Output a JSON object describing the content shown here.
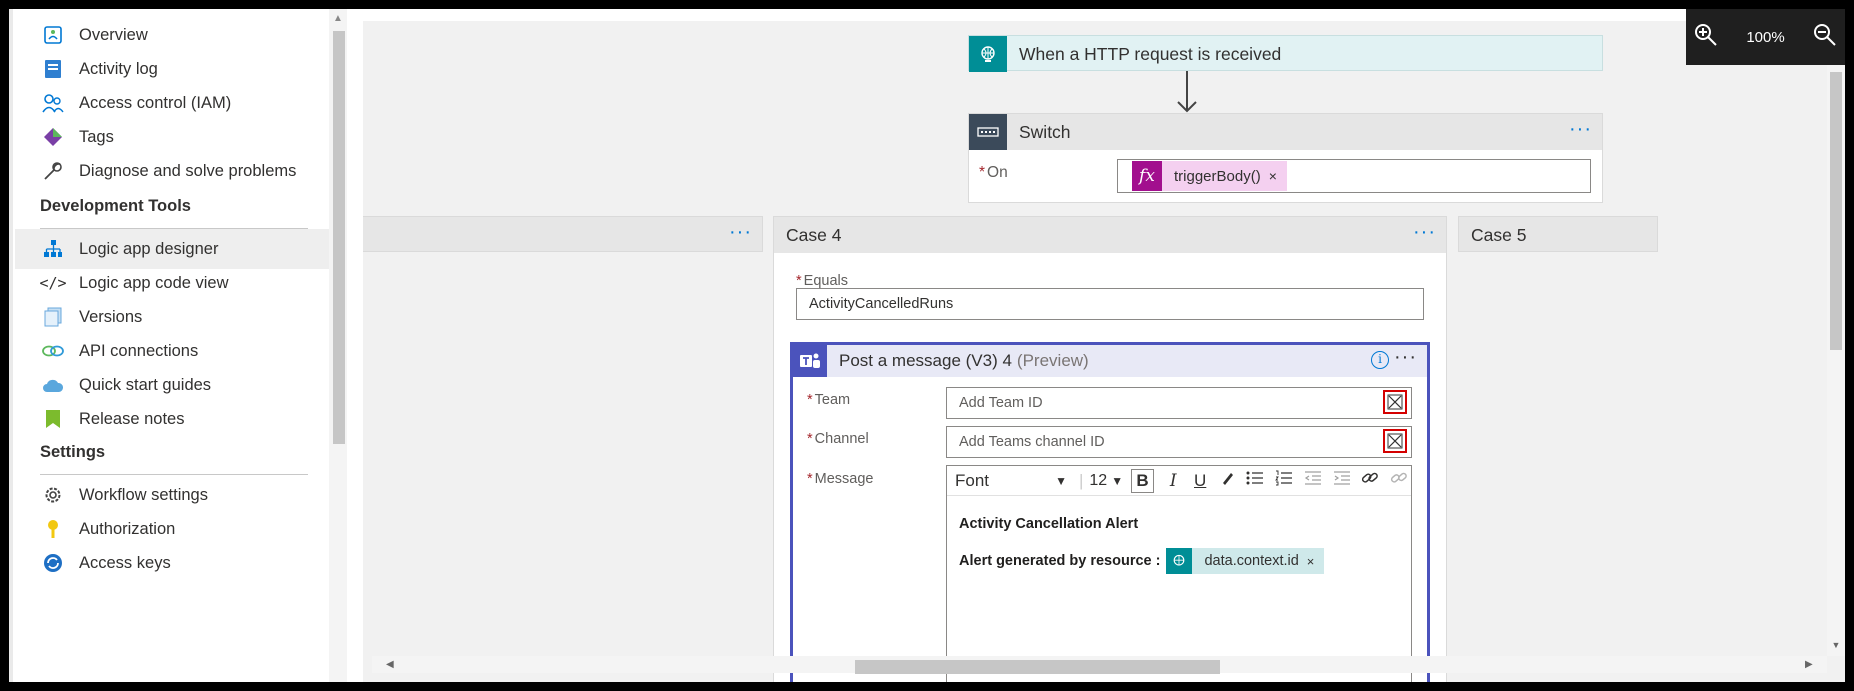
{
  "sidebar": {
    "items_top": [
      {
        "label": "Overview",
        "icon": "overview-icon"
      },
      {
        "label": "Activity log",
        "icon": "activity-log-icon"
      },
      {
        "label": "Access control (IAM)",
        "icon": "people-icon"
      },
      {
        "label": "Tags",
        "icon": "tag-icon"
      },
      {
        "label": "Diagnose and solve problems",
        "icon": "wrench-icon"
      }
    ],
    "dev_section_title": "Development Tools",
    "items_dev": [
      {
        "label": "Logic app designer",
        "icon": "designer-icon"
      },
      {
        "label": "Logic app code view",
        "icon": "code-icon"
      },
      {
        "label": "Versions",
        "icon": "versions-icon"
      },
      {
        "label": "API connections",
        "icon": "link-icon"
      },
      {
        "label": "Quick start guides",
        "icon": "cloud-icon"
      },
      {
        "label": "Release notes",
        "icon": "bookmark-icon"
      }
    ],
    "settings_section_title": "Settings",
    "items_settings": [
      {
        "label": "Workflow settings",
        "icon": "gear-icon"
      },
      {
        "label": "Authorization",
        "icon": "key-icon"
      },
      {
        "label": "Access keys",
        "icon": "refresh-key-icon"
      }
    ]
  },
  "designer": {
    "trigger_title": "When a HTTP request is received",
    "switch_title": "Switch",
    "switch_on_label": "On",
    "switch_on_token": "triggerBody()",
    "token_fx": "fx",
    "case4_title": "Case 4",
    "case5_title": "Case 5",
    "equals_label": "Equals",
    "equals_value": "ActivityCancelledRuns",
    "action_title": "Post a message (V3) 4",
    "action_preview": "(Preview)",
    "team_label": "Team",
    "team_placeholder": "Add Team ID",
    "channel_label": "Channel",
    "channel_placeholder": "Add Teams channel ID",
    "message_label": "Message",
    "font_label": "Font",
    "font_size": "12",
    "message_line1": "Activity Cancellation Alert",
    "message_line2": "Alert generated by resource :",
    "message_token": "data.context.id",
    "required_marker": "*"
  },
  "zoom": {
    "level": "100%"
  },
  "colors": {
    "accent": "#0078d4",
    "trigger_teal": "#008e96",
    "switch_dark": "#3b4a5a",
    "teams_purple": "#4b53bc",
    "fx_magenta": "#a20f8e"
  }
}
